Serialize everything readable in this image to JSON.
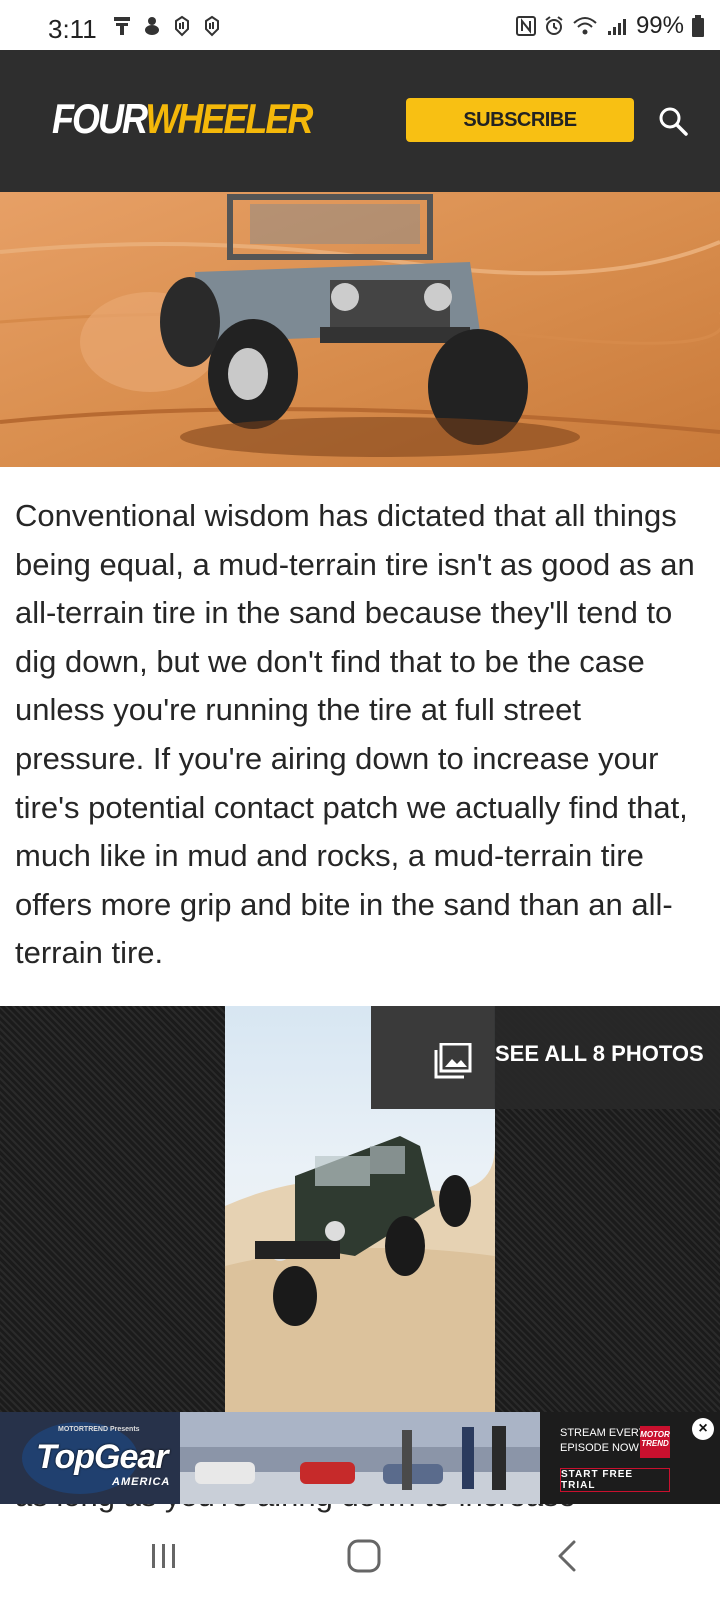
{
  "status_bar": {
    "time": "3:11",
    "battery": "99%",
    "left_icons": [
      "notification-icon",
      "notification-icon",
      "hand-icon",
      "hand-icon"
    ],
    "right_icons": [
      "nfc-icon",
      "alarm-icon",
      "wifi-icon",
      "signal-icon",
      "battery-icon"
    ]
  },
  "header": {
    "logo_part1": "FOUR",
    "logo_part2": "WHEELER",
    "subscribe_label": "SUBSCRIBE",
    "brand_color": "#f4b80a",
    "background": "#2e2e2e"
  },
  "article": {
    "paragraph": "Conventional wisdom has dictated that all things being equal, a mud-terrain tire isn't as good as an all-terrain tire in the sand because they'll tend to dig down, but we don't find that to be the case unless you're running the tire at full street pressure. If you're airing down to increase your tire's potential contact patch we actually find that, much like in mud and rocks, a mud-terrain tire offers more grip and bite in the sand than an all-terrain tire.",
    "peek_text": "as long as you're airing down to increase"
  },
  "gallery": {
    "see_all_label": "SEE ALL 8 PHOTOS"
  },
  "ad": {
    "presents": "MOTORTREND Presents",
    "title": "TopGear",
    "subtitle": "AMERICA",
    "stream_line1": "STREAM EVERY",
    "stream_line2": "EPISODE NOW",
    "badge": "MOTOR TREND",
    "cta": "START FREE TRIAL",
    "close": "×"
  }
}
